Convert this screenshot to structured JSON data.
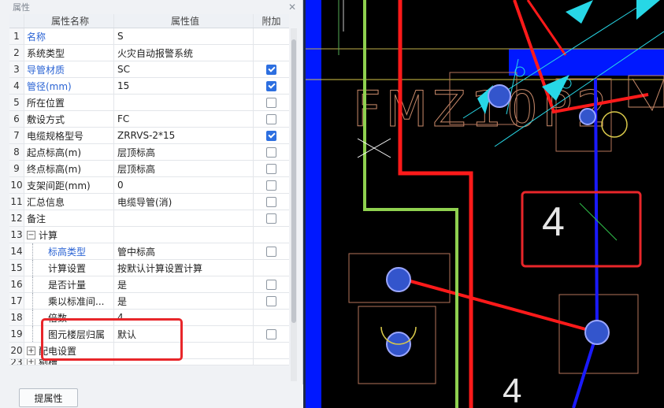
{
  "panel": {
    "title": "属性",
    "columns": {
      "index": "",
      "name": "属性名称",
      "value": "属性值",
      "add": "附加"
    },
    "rows": [
      {
        "idx": "1",
        "name": "名称",
        "value": "S",
        "blue": true,
        "checkbox": "none"
      },
      {
        "idx": "2",
        "name": "系统类型",
        "value": "火灾自动报警系统",
        "blue": false,
        "checkbox": "none"
      },
      {
        "idx": "3",
        "name": "导管材质",
        "value": "SC",
        "blue": true,
        "checkbox": "on"
      },
      {
        "idx": "4",
        "name": "管径(mm)",
        "value": "15",
        "blue": true,
        "checkbox": "on"
      },
      {
        "idx": "5",
        "name": "所在位置",
        "value": "",
        "blue": false,
        "checkbox": "off"
      },
      {
        "idx": "6",
        "name": "敷设方式",
        "value": "FC",
        "blue": false,
        "checkbox": "off"
      },
      {
        "idx": "7",
        "name": "电缆规格型号",
        "value": "ZRRVS-2*15",
        "blue": false,
        "checkbox": "on"
      },
      {
        "idx": "8",
        "name": "起点标高(m)",
        "value": "层顶标高",
        "blue": false,
        "checkbox": "off"
      },
      {
        "idx": "9",
        "name": "终点标高(m)",
        "value": "层顶标高",
        "blue": false,
        "checkbox": "off"
      },
      {
        "idx": "10",
        "name": "支架间距(mm)",
        "value": "0",
        "blue": false,
        "checkbox": "off"
      },
      {
        "idx": "11",
        "name": "汇总信息",
        "value": "电缆导管(消)",
        "blue": false,
        "checkbox": "off"
      },
      {
        "idx": "12",
        "name": "备注",
        "value": "",
        "blue": false,
        "checkbox": "off"
      },
      {
        "idx": "13",
        "name": "计算",
        "value": "",
        "blue": false,
        "checkbox": "none",
        "group": "minus"
      },
      {
        "idx": "14",
        "name": "标高类型",
        "value": "管中标高",
        "blue": true,
        "checkbox": "off",
        "child": true
      },
      {
        "idx": "15",
        "name": "计算设置",
        "value": "按默认计算设置计算",
        "blue": false,
        "checkbox": "none",
        "child": true
      },
      {
        "idx": "16",
        "name": "是否计量",
        "value": "是",
        "blue": false,
        "checkbox": "off",
        "child": true
      },
      {
        "idx": "17",
        "name": "乘以标准间...",
        "value": "是",
        "blue": false,
        "checkbox": "off",
        "child": true
      },
      {
        "idx": "18",
        "name": "倍数",
        "value": "4",
        "blue": false,
        "checkbox": "none",
        "child": true
      },
      {
        "idx": "19",
        "name": "图元楼层归属",
        "value": "默认",
        "blue": false,
        "checkbox": "off",
        "child": true
      },
      {
        "idx": "20",
        "name": "配电设置",
        "value": "",
        "blue": false,
        "checkbox": "none",
        "group": "plus"
      },
      {
        "idx": "23",
        "name": "剔槽",
        "value": "",
        "blue": false,
        "checkbox": "none",
        "group": "plus"
      }
    ],
    "button": "提属性"
  },
  "cad": {
    "text_fm": "FMZ10P2",
    "box_label": "4",
    "bottom_label": "4",
    "colors": {
      "red": "#ff1a1a",
      "blue": "#1a1aff",
      "green": "#8fd14f",
      "cyan": "#27d7e6",
      "orange": "#b5735a"
    }
  }
}
